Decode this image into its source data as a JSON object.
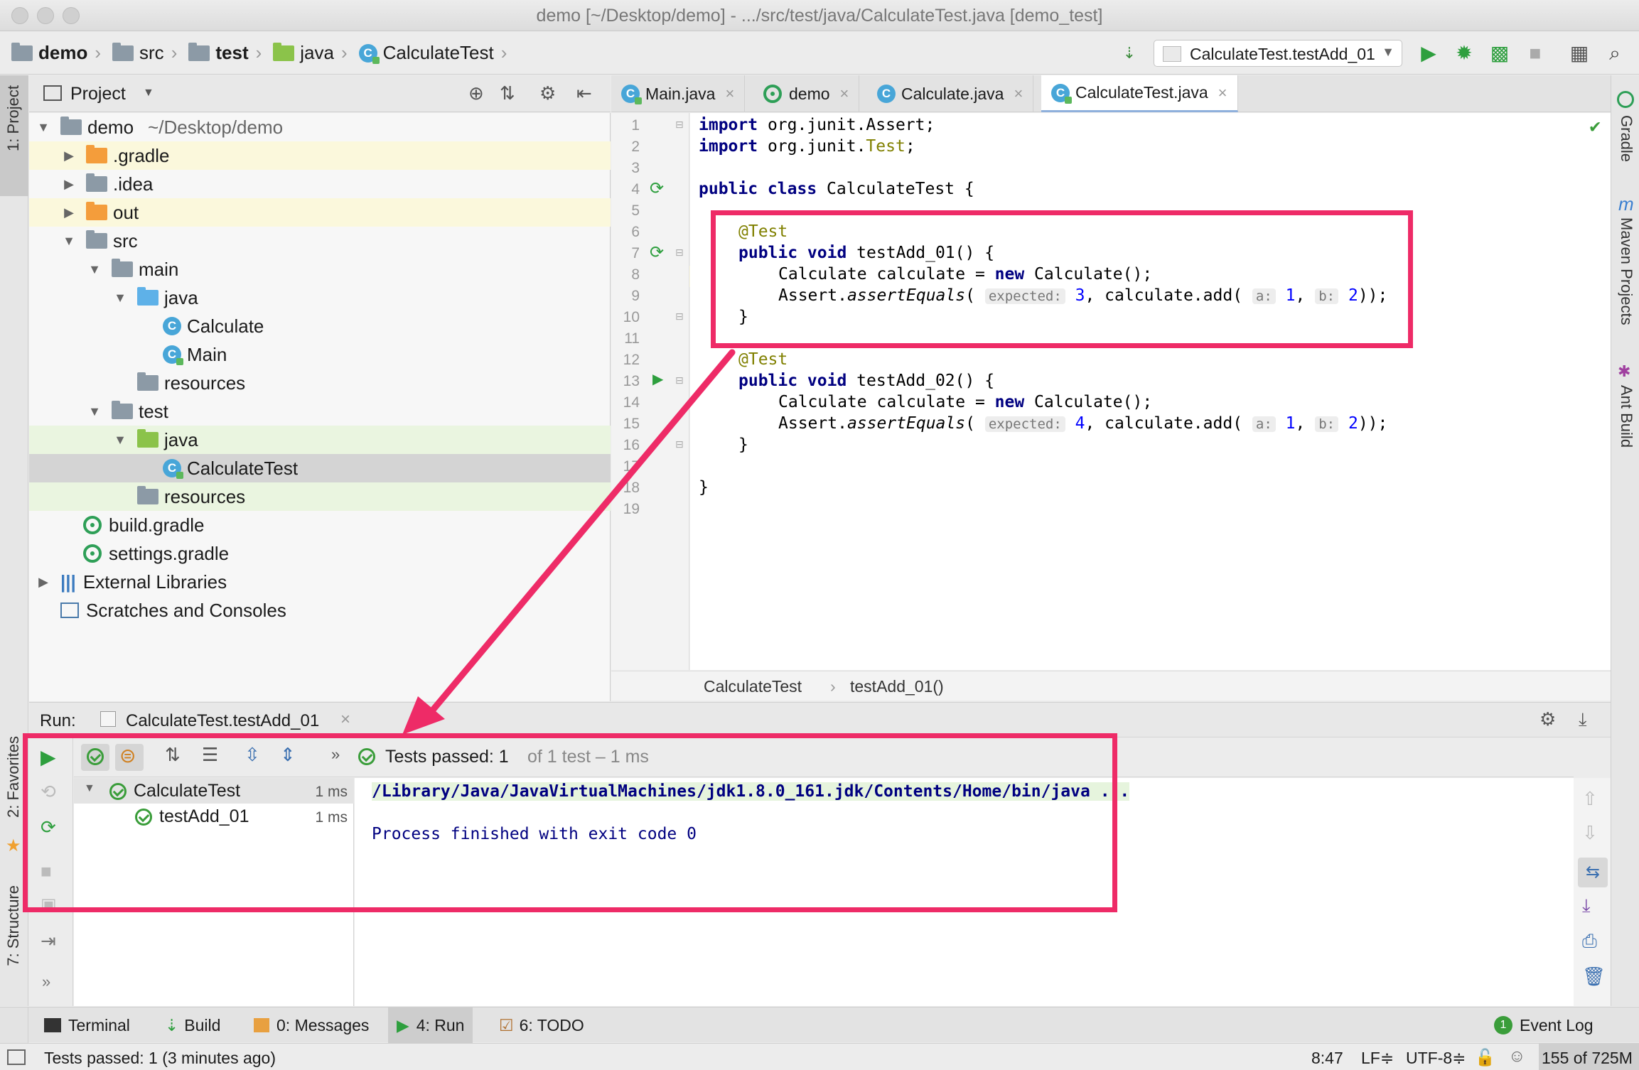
{
  "window": {
    "title": "demo [~/Desktop/demo] - .../src/test/java/CalculateTest.java [demo_test]"
  },
  "navbar": {
    "crumbs": [
      "demo",
      "src",
      "test",
      "java",
      "CalculateTest"
    ],
    "run_config": "CalculateTest.testAdd_01"
  },
  "left_strip": {
    "project": "1: Project",
    "favorites": "2: Favorites",
    "structure": "7: Structure"
  },
  "right_strip": {
    "gradle": "Gradle",
    "maven": "Maven Projects",
    "ant": "Ant Build"
  },
  "project_panel": {
    "title": "Project",
    "tree": [
      {
        "label": "demo",
        "extra": "~/Desktop/demo"
      },
      {
        "label": ".gradle"
      },
      {
        "label": ".idea"
      },
      {
        "label": "out"
      },
      {
        "label": "src"
      },
      {
        "label": "main"
      },
      {
        "label": "java"
      },
      {
        "label": "Calculate"
      },
      {
        "label": "Main"
      },
      {
        "label": "resources"
      },
      {
        "label": "test"
      },
      {
        "label": "java"
      },
      {
        "label": "CalculateTest"
      },
      {
        "label": "resources"
      },
      {
        "label": "build.gradle"
      },
      {
        "label": "settings.gradle"
      },
      {
        "label": "External Libraries"
      },
      {
        "label": "Scratches and Consoles"
      }
    ]
  },
  "editor": {
    "tabs": [
      "Main.java",
      "demo",
      "Calculate.java",
      "CalculateTest.java"
    ],
    "active_tab": "CalculateTest.java",
    "line_numbers": [
      "1",
      "2",
      "3",
      "4",
      "5",
      "6",
      "7",
      "8",
      "9",
      "10",
      "11",
      "12",
      "13",
      "14",
      "15",
      "16",
      "17",
      "18",
      "19"
    ],
    "code": {
      "l1_kw": "import",
      "l1_rest": " org.junit.Assert;",
      "l2_kw": "import",
      "l2_rest": " org.junit.",
      "l2_ann": "Test",
      "l2_end": ";",
      "l4_kw": "public class",
      "l4_rest": " CalculateTest {",
      "ann_test": "@Test",
      "l7_kw": "public void",
      "l7_rest": " testAdd_01() {",
      "l8_pre": "Calculate calculate = ",
      "l8_kw": "new",
      "l8_rest": " Calculate();",
      "assert_pre": "Assert.",
      "assert_call": "assertEquals",
      "assert_open": "( ",
      "hint_expected": "expected:",
      "l9_val": "3",
      "mid": ", calculate.add( ",
      "hint_a": "a:",
      "val_1": "1",
      "comma": ", ",
      "hint_b": "b:",
      "val_2": "2",
      "close": "));",
      "brace_close": "}",
      "l13_kw": "public void",
      "l13_rest": " testAdd_02() {",
      "l15_val": "4"
    },
    "breadcrumb": [
      "CalculateTest",
      "testAdd_01()"
    ]
  },
  "run_panel": {
    "label": "Run:",
    "tab": "CalculateTest.testAdd_01",
    "status_prefix": "Tests passed: 1",
    "status_suffix": "of 1 test – 1 ms",
    "tests": [
      {
        "name": "CalculateTest",
        "time": "1 ms"
      },
      {
        "name": "testAdd_01",
        "time": "1 ms"
      }
    ],
    "console_lines": [
      "/Library/Java/JavaVirtualMachines/jdk1.8.0_161.jdk/Contents/Home/bin/java ...",
      "Process finished with exit code 0"
    ]
  },
  "tool_windows": {
    "terminal": "Terminal",
    "build": "Build",
    "messages": "0: Messages",
    "run": "4: Run",
    "todo": "6: TODO",
    "event_log": "Event Log",
    "event_count": "1"
  },
  "status_bar": {
    "message": "Tests passed: 1 (3 minutes ago)",
    "position": "8:47",
    "line_sep": "LF≑",
    "encoding": "UTF-8≑",
    "memory": "155 of 725M"
  },
  "colors": {
    "highlight": "#ee2b67",
    "run_green": "#2e9f3e",
    "keyword": "#000080"
  }
}
